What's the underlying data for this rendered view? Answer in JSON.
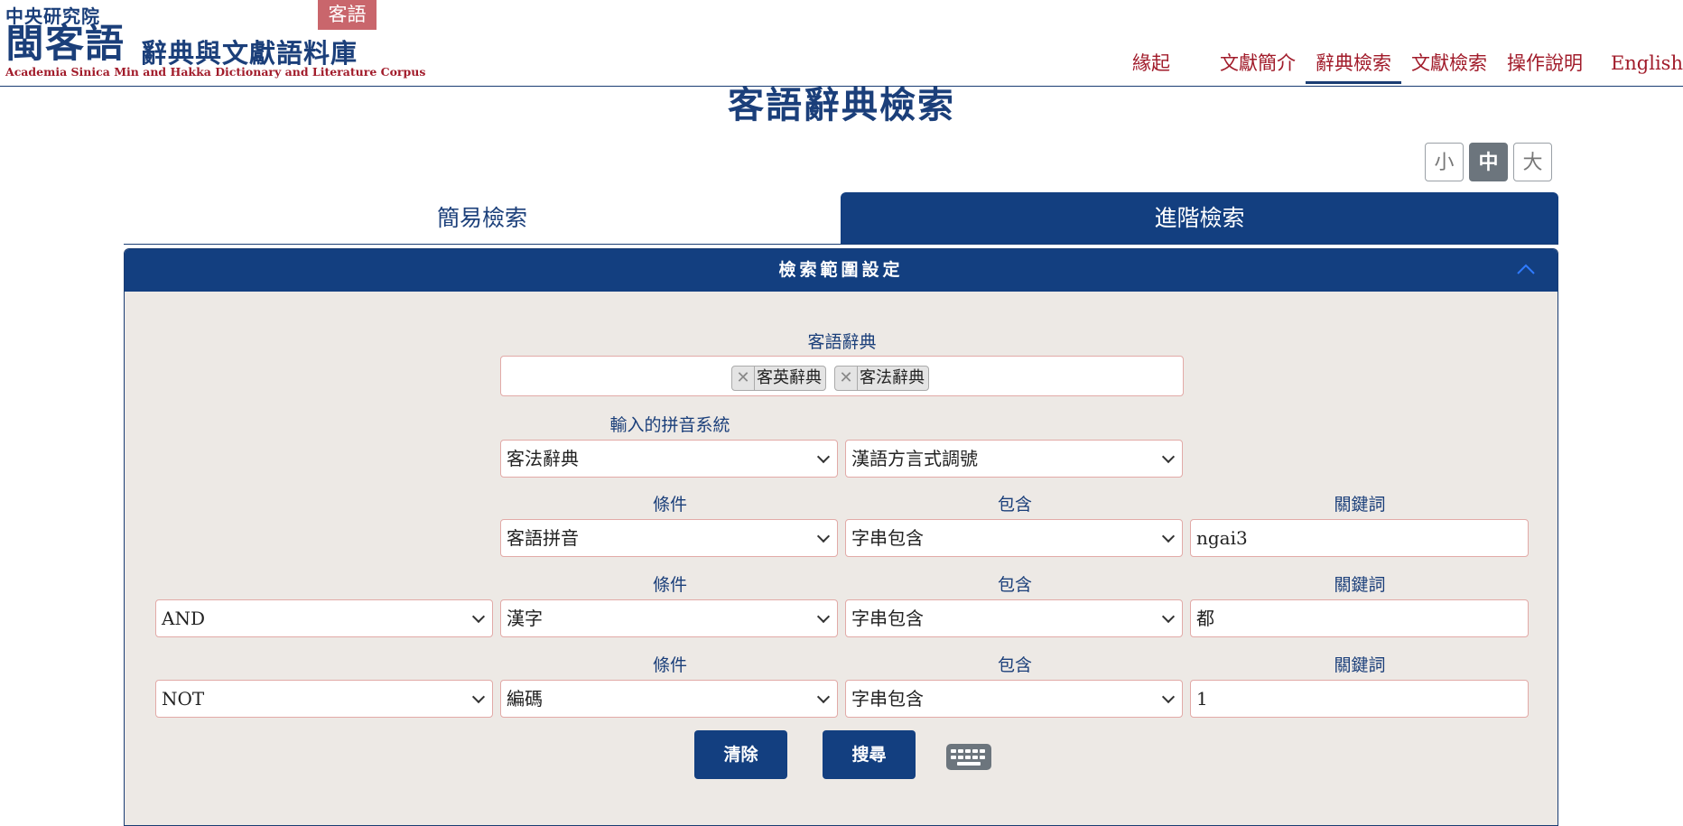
{
  "header": {
    "logo": {
      "line1": "中央研究院",
      "main": "閩客語",
      "sub": "辭典與文獻語料庫",
      "english": "Academia Sinica Min and Hakka Dictionary and Literature Corpus"
    },
    "lang_badge": "客語",
    "nav": [
      {
        "label": "緣起",
        "active": false
      },
      {
        "label": "文獻簡介",
        "active": false
      },
      {
        "label": "辭典檢索",
        "active": true
      },
      {
        "label": "文獻檢索",
        "active": false
      },
      {
        "label": "操作說明",
        "active": false
      },
      {
        "label": "English",
        "active": false
      }
    ]
  },
  "page_title": "客語辭典檢索",
  "font_sizes": {
    "small": "小",
    "medium": "中",
    "large": "大",
    "selected": "中"
  },
  "tabs": {
    "simple": "簡易檢索",
    "advanced": "進階檢索",
    "active": "advanced"
  },
  "panel": {
    "title": "檢索範圍設定",
    "dictionary_label": "客語辭典",
    "dictionaries": [
      "客英辭典",
      "客法辭典"
    ],
    "pinyin_label": "輸入的拼音系統",
    "pinyin_dict": "客法辭典",
    "pinyin_system": "漢語方言式調號",
    "col_labels": {
      "condition": "條件",
      "match": "包含",
      "keyword": "關鍵詞"
    },
    "rows": [
      {
        "logic": "",
        "condition": "客語拼音",
        "match": "字串包含",
        "keyword": "ngai3"
      },
      {
        "logic": "AND",
        "condition": "漢字",
        "match": "字串包含",
        "keyword": "都"
      },
      {
        "logic": "NOT",
        "condition": "編碼",
        "match": "字串包含",
        "keyword": "1"
      }
    ],
    "clear_label": "清除",
    "search_label": "搜尋"
  },
  "colors": {
    "primary": "#133f80",
    "nav_red": "#a11b2a",
    "panel_bg": "#ede9e5",
    "badge": "#c9666c"
  },
  "icons": {
    "collapse": "chevron-up-icon",
    "keyboard": "keyboard-icon",
    "tag_remove": "close-icon"
  }
}
